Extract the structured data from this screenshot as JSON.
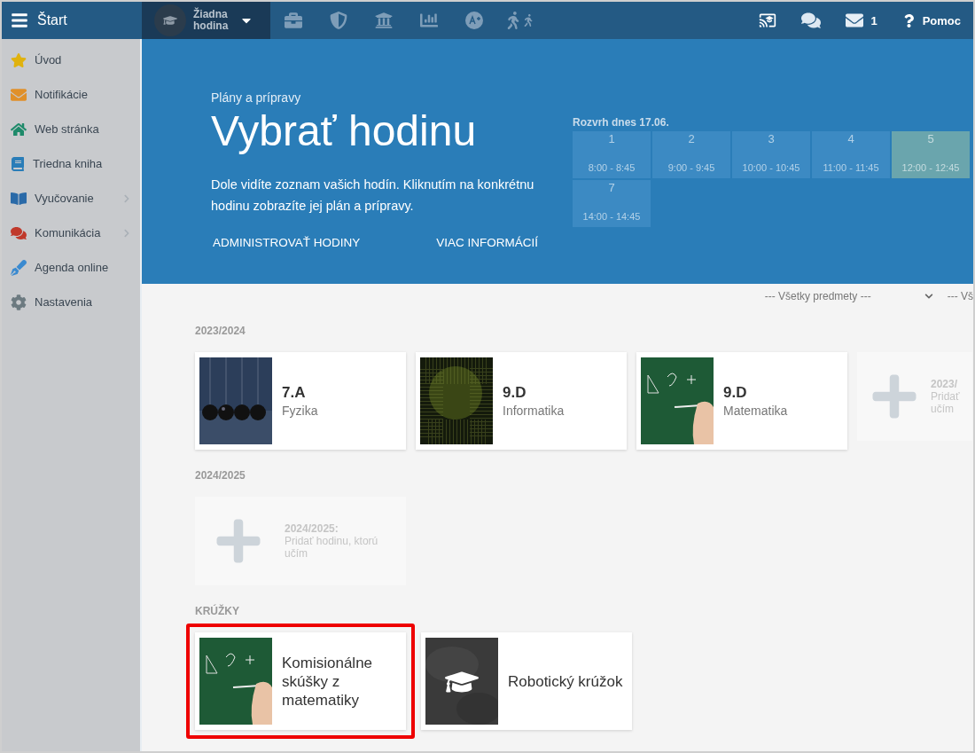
{
  "topbar": {
    "menu_label": "Štart",
    "lesson": "Žiadna hodina",
    "messages_count": "1",
    "help": "Pomoc"
  },
  "sidebar": {
    "items": [
      {
        "label": "Úvod",
        "submenu": false
      },
      {
        "label": "Notifikácie",
        "submenu": false
      },
      {
        "label": "Web stránka",
        "submenu": false
      },
      {
        "label": "Triedna kniha",
        "submenu": false
      },
      {
        "label": "Vyučovanie",
        "submenu": true
      },
      {
        "label": "Komunikácia",
        "submenu": true
      },
      {
        "label": "Agenda online",
        "submenu": false
      },
      {
        "label": "Nastavenia",
        "submenu": false
      }
    ]
  },
  "hero": {
    "subtitle": "Plány a prípravy",
    "title": "Vybrať hodinu",
    "text": "Dole vidíte zoznam vašich hodín. Kliknutím na konkrétnu hodinu zobrazíte jej plán a prípravy.",
    "links": [
      "ADMINISTROVAŤ HODINY",
      "VIAC INFORMÁCIÍ"
    ],
    "schedule": {
      "label": "Rozvrh dnes 17.06.",
      "slots": [
        {
          "number": "1",
          "time": "8:00 - 8:45",
          "selected": false
        },
        {
          "number": "2",
          "time": "9:00 - 9:45",
          "selected": false
        },
        {
          "number": "3",
          "time": "10:00 - 10:45",
          "selected": false
        },
        {
          "number": "4",
          "time": "11:00 - 11:45",
          "selected": false
        },
        {
          "number": "5",
          "time": "12:00 - 12:45",
          "selected": true
        },
        {
          "number": "7",
          "time": "14:00 - 14:45",
          "selected": false
        }
      ]
    }
  },
  "filters": [
    {
      "value": "--- Všetky predmety ---"
    },
    {
      "value": "--- Vš"
    }
  ],
  "sections": [
    {
      "heading": "2023/2024",
      "cards": [
        {
          "kind": "class",
          "title": "7.A",
          "subtitle": "Fyzika",
          "highlighted": false
        },
        {
          "kind": "class",
          "title": "9.D",
          "subtitle": "Informatika",
          "highlighted": false
        },
        {
          "kind": "class",
          "title": "9.D",
          "subtitle": "Matematika",
          "highlighted": false
        },
        {
          "kind": "add",
          "title": "2023/",
          "subtitle": "Pridať učím",
          "highlighted": false
        }
      ]
    },
    {
      "heading": "2024/2025",
      "cards": [
        {
          "kind": "add",
          "title": "2024/2025:",
          "subtitle": "Pridať hodinu, ktorú učím",
          "highlighted": false
        }
      ]
    },
    {
      "heading": "KRÚŽKY",
      "cards": [
        {
          "kind": "club",
          "title": "Komisionálne skúšky z matematiky",
          "highlighted": true
        },
        {
          "kind": "club",
          "title": "Robotický krúžok",
          "highlighted": false
        }
      ]
    }
  ]
}
